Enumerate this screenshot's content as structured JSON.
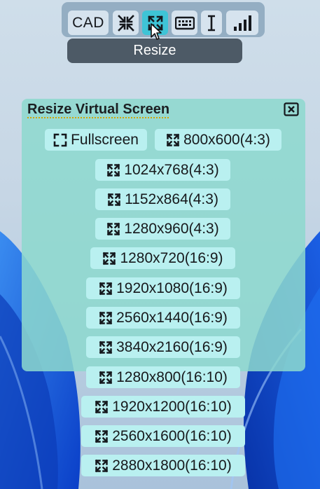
{
  "toolbar": {
    "cad_label": "CAD",
    "buttons": [
      {
        "icon": "collapse-arrows-icon"
      },
      {
        "icon": "resize-arrows-icon",
        "active": true
      },
      {
        "icon": "keyboard-icon"
      },
      {
        "icon": "text-cursor-icon"
      },
      {
        "icon": "signal-bars-icon"
      }
    ],
    "accent_color": "#3ec4d6"
  },
  "tooltip": {
    "text": "Resize"
  },
  "panel": {
    "title": "Resize Virtual Screen",
    "close_icon": "close-box-icon",
    "options": [
      {
        "label": "Fullscreen",
        "icon": "fullscreen-icon"
      },
      {
        "label": "800x600(4:3)",
        "icon": "resize-arrows-icon"
      },
      {
        "label": "1024x768(4:3)",
        "icon": "resize-arrows-icon"
      },
      {
        "label": "1152x864(4:3)",
        "icon": "resize-arrows-icon"
      },
      {
        "label": "1280x960(4:3)",
        "icon": "resize-arrows-icon"
      },
      {
        "label": "1280x720(16:9)",
        "icon": "resize-arrows-icon"
      },
      {
        "label": "1920x1080(16:9)",
        "icon": "resize-arrows-icon"
      },
      {
        "label": "2560x1440(16:9)",
        "icon": "resize-arrows-icon"
      },
      {
        "label": "3840x2160(16:9)",
        "icon": "resize-arrows-icon"
      },
      {
        "label": "1280x800(16:10)",
        "icon": "resize-arrows-icon"
      },
      {
        "label": "1920x1200(16:10)",
        "icon": "resize-arrows-icon"
      },
      {
        "label": "2560x1600(16:10)",
        "icon": "resize-arrows-icon"
      },
      {
        "label": "2880x1800(16:10)",
        "icon": "resize-arrows-icon"
      }
    ]
  }
}
